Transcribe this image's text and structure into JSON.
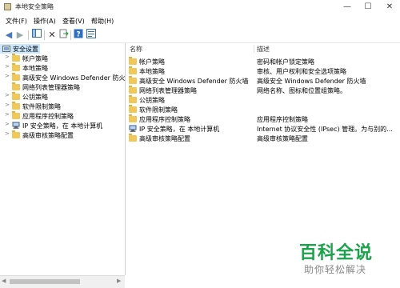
{
  "window": {
    "title": "本地安全策略",
    "controls": [
      "—",
      "☐",
      "✕"
    ]
  },
  "menu": [
    "文件(F)",
    "操作(A)",
    "查看(V)",
    "帮助(H)"
  ],
  "toolbar": {
    "icons": [
      "back-icon",
      "forward-icon",
      "show-tree-icon",
      "delete-icon",
      "export-icon",
      "help-icon",
      "properties-icon"
    ]
  },
  "tree": {
    "root": "安全设置",
    "items": [
      {
        "label": "帐户策略",
        "icon": "folder"
      },
      {
        "label": "本地策略",
        "icon": "folder"
      },
      {
        "label": "高级安全 Windows Defender 防火墙",
        "icon": "folder"
      },
      {
        "label": "网络列表管理器策略",
        "icon": "folder"
      },
      {
        "label": "公钥策略",
        "icon": "folder"
      },
      {
        "label": "软件限制策略",
        "icon": "folder"
      },
      {
        "label": "应用程序控制策略",
        "icon": "folder"
      },
      {
        "label": "IP 安全策略，在 本地计算机",
        "icon": "ipsec"
      },
      {
        "label": "高级审核策略配置",
        "icon": "folder"
      }
    ]
  },
  "list": {
    "columns": {
      "name": "名称",
      "desc": "描述"
    },
    "rows": [
      {
        "name": "帐户策略",
        "desc": "密码和帐户锁定策略",
        "icon": "folder"
      },
      {
        "name": "本地策略",
        "desc": "审核、用户权利和安全选项策略",
        "icon": "folder"
      },
      {
        "name": "高级安全 Windows Defender 防火墙",
        "desc": "高级安全 Windows Defender 防火墙",
        "icon": "folder"
      },
      {
        "name": "网络列表管理器策略",
        "desc": "网络名称、图标和位置组策略。",
        "icon": "folder"
      },
      {
        "name": "公钥策略",
        "desc": "",
        "icon": "folder"
      },
      {
        "name": "软件限制策略",
        "desc": "",
        "icon": "folder"
      },
      {
        "name": "应用程序控制策略",
        "desc": "应用程序控制策略",
        "icon": "folder"
      },
      {
        "name": "IP 安全策略，在 本地计算机",
        "desc": "Internet 协议安全性 (IPsec) 管理。为与别的...",
        "icon": "ipsec"
      },
      {
        "name": "高级审核策略配置",
        "desc": "高级审核策略配置",
        "icon": "folder"
      }
    ]
  },
  "watermark": {
    "main": "百科全说",
    "sub": "助你轻松解决"
  },
  "colors": {
    "selection": "#cce8ff",
    "folder": "#f0c85a",
    "watermark": "#1aa34a"
  }
}
